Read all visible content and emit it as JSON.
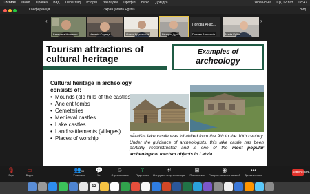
{
  "menubar": {
    "items": [
      "Chrome",
      "Файл",
      "Правка",
      "Вид",
      "Перегляд",
      "Історія",
      "Закладки",
      "Профіл",
      "Вікно",
      "Довідка"
    ],
    "right": [
      "Українська",
      "Ср, 12 пат.",
      "08:47"
    ]
  },
  "titlebar": {
    "conference": "Конференція",
    "view": "Экран (Marta Eglite)",
    "right": "Вид"
  },
  "participants": [
    {
      "name": "Катерина Нікіпенко"
    },
    {
      "name": "Наталія Середа"
    },
    {
      "name": "Олеся Круковська"
    },
    {
      "name": "Вікторія Дуга"
    },
    {
      "name": "Попова Анастасія",
      "display": "Попова Анас..."
    },
    {
      "name": "Marta Eglite"
    }
  ],
  "slide": {
    "title": "Tourism attractions of cultural heritage",
    "box_line1": "Examples of",
    "box_line2": "archeology",
    "list_heading": "Cultural heritage in archeology consists of:",
    "list": [
      "Mounds (old hills of the castles)",
      "Ancient tombs",
      "Cemeteries",
      "Medieval castles",
      "Lake castles",
      "Land settlements (villages)",
      "Places of worship"
    ],
    "caption_main": "«Āraiši» lake castle was inhabited from the 9th to the 10th century. Under the guidance of archeologists, this lake castle has been partially reconstructed and is one of the",
    "caption_bold": "most popular archeological tourism objects in Latvia",
    "caption_end": "."
  },
  "toolbar": {
    "items": [
      {
        "label": "Звук",
        "icon": "microphone-icon"
      },
      {
        "label": "Видео",
        "icon": "video-icon"
      },
      {
        "label": "Участники",
        "icon": "participants-icon",
        "count": "35"
      },
      {
        "label": "Чат",
        "icon": "chat-icon"
      },
      {
        "label": "Отреагировать",
        "icon": "react-icon"
      },
      {
        "label": "Поделиться",
        "icon": "share-icon"
      },
      {
        "label": "Инструменты организатора",
        "icon": "host-tools-icon"
      },
      {
        "label": "Приложения",
        "icon": "apps-icon"
      },
      {
        "label": "Распространитель записей",
        "icon": "record-icon"
      },
      {
        "label": "Дополнительно",
        "icon": "more-icon"
      }
    ],
    "end": "Завершить"
  },
  "dock": {
    "calendar_day": "12"
  }
}
